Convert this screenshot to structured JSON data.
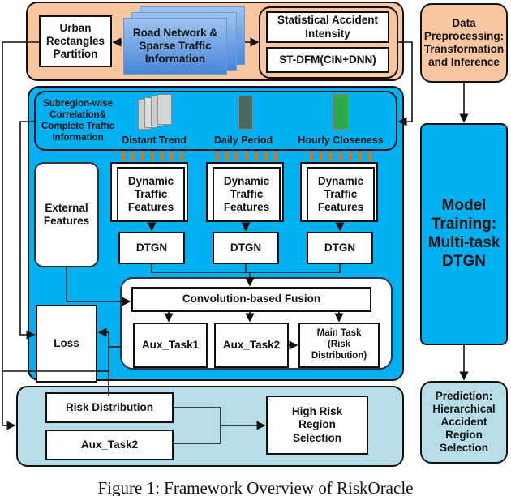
{
  "top_panel": {
    "urban_partition": "Urban Rectangles Partition",
    "road_network": "Road Network & Sparse Traffic Information",
    "statistical_intensity": "Statistical Accident Intensity",
    "st_dfm": "ST-DFM(CIN+DNN)"
  },
  "middle_panel": {
    "subregion_label": "Subregion-wise Correlation& Complete Traffic Information",
    "distant_trend": "Distant Trend",
    "daily_period": "Daily Period",
    "hourly_closeness": "Hourly Closeness",
    "dynamic_features": [
      "Dynamic Traffic Features",
      "Dynamic Traffic Features",
      "Dynamic Traffic Features"
    ],
    "dtgn": [
      "DTGN",
      "DTGN",
      "DTGN"
    ],
    "external_features": "External Features",
    "fusion": "Convolution-based Fusion",
    "aux_task1": "Aux_Task1",
    "aux_task2": "Aux_Task2",
    "main_task": "Main Task (Risk Distribution)",
    "loss": "Loss"
  },
  "bottom_panel": {
    "risk_distribution": "Risk Distribution",
    "aux_task2": "Aux_Task2",
    "high_risk": "High Risk Region Selection"
  },
  "stages": {
    "preprocessing": "Data Preprocessing: Transformation and Inference",
    "training": "Model Training: Multi-task DTGN",
    "prediction": "Prediction: Hierarchical Accident Region Selection"
  },
  "caption": "Figure 1: Framework Overview of RiskOracle",
  "colors": {
    "orange": "#f8c6a0",
    "blue": "#00b0f0",
    "light_blue": "#b7dde8",
    "stripe": "#e07020"
  }
}
